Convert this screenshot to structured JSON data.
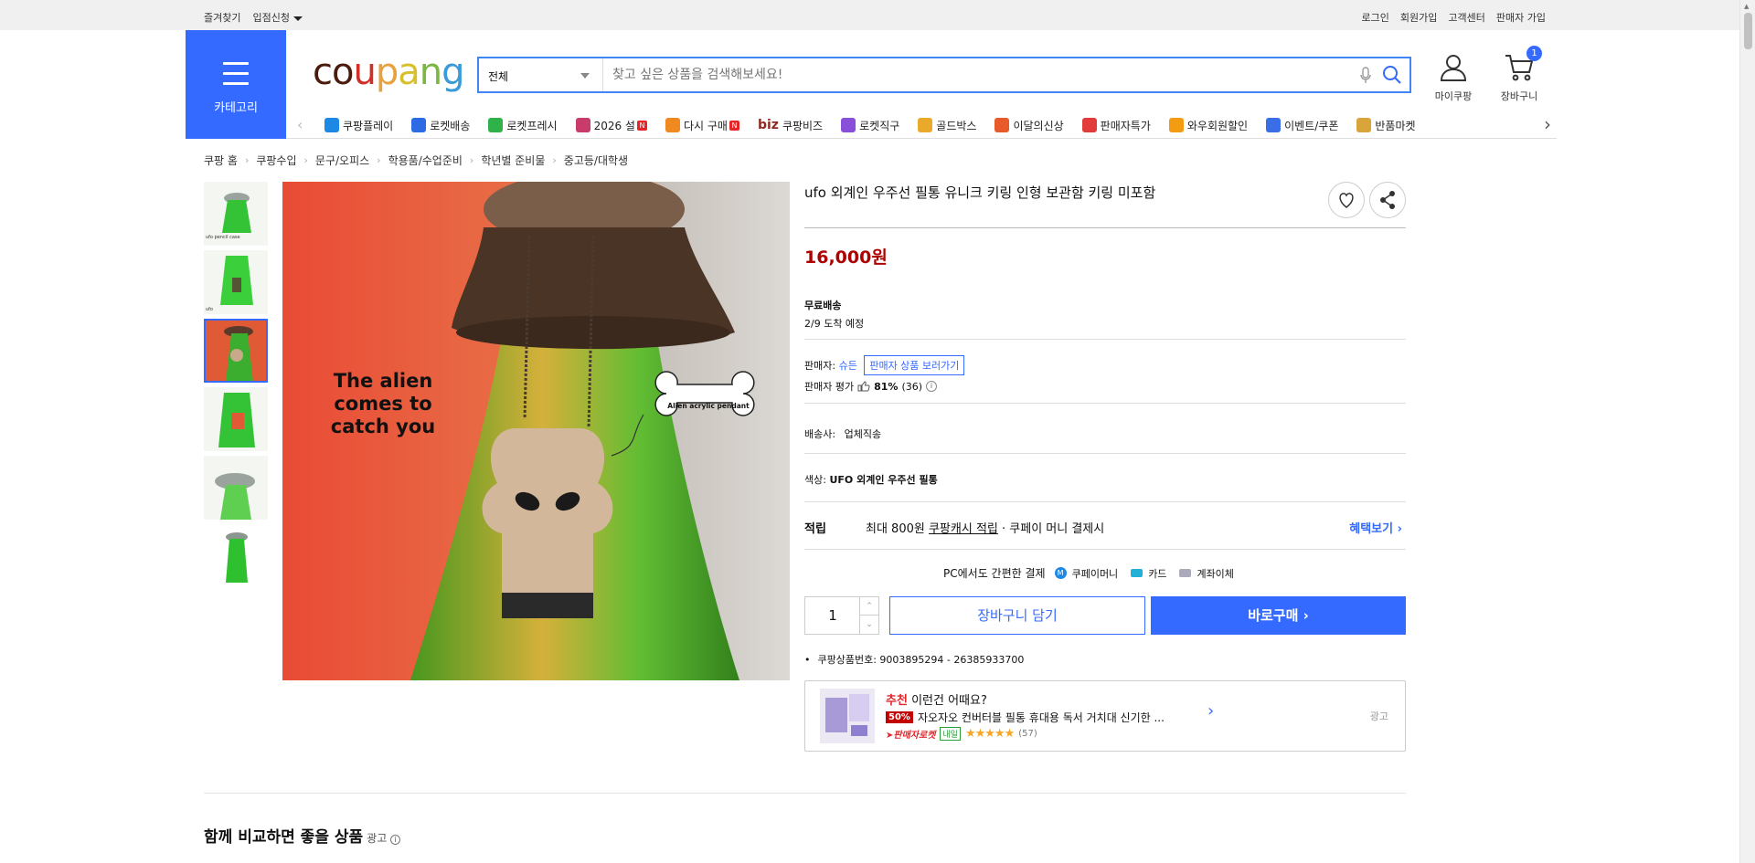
{
  "topbar": {
    "favorites": "즐겨찾기",
    "entry": "입점신청",
    "login": "로그인",
    "signup": "회원가입",
    "support": "고객센터",
    "seller_signup": "판매자 가입"
  },
  "header": {
    "category_label": "카테고리",
    "logo_letters": [
      "c",
      "o",
      "u",
      "p",
      "a",
      "n",
      "g"
    ],
    "logo_colors": [
      "#4b1b0e",
      "#4b1b0e",
      "#d03028",
      "#e7a23f",
      "#d6c12c",
      "#7ab743",
      "#3a9bd9"
    ],
    "search_scope": "전체",
    "search_placeholder": "찾고 싶은 상품을 검색해보세요!",
    "mycoupang": "마이쿠팡",
    "cart": "장바구니",
    "cart_count": "1"
  },
  "nav": {
    "items": [
      {
        "label": "쿠팡플레이",
        "color": "#1e88e5",
        "new": ""
      },
      {
        "label": "로켓배송",
        "color": "#2d6ae3",
        "new": ""
      },
      {
        "label": "로켓프레시",
        "color": "#30b24a",
        "new": ""
      },
      {
        "label": "2026 설",
        "color": "#c73c6a",
        "new": "N"
      },
      {
        "label": "다시 구매",
        "color": "#f08a20",
        "new": "N"
      },
      {
        "label": "쿠팡비즈",
        "color": "#8e2b1f",
        "new": "",
        "prefix": "biz"
      },
      {
        "label": "로켓직구",
        "color": "#8a4fd8",
        "new": ""
      },
      {
        "label": "골드박스",
        "color": "#e9a92a",
        "new": ""
      },
      {
        "label": "이달의신상",
        "color": "#e85a2b",
        "new": ""
      },
      {
        "label": "판매자특가",
        "color": "#e23b3b",
        "new": ""
      },
      {
        "label": "와우회원할인",
        "color": "#f39c12",
        "new": ""
      },
      {
        "label": "이벤트/쿠폰",
        "color": "#3a6ee8",
        "new": ""
      },
      {
        "label": "반품마켓",
        "color": "#d9a43a",
        "new": ""
      }
    ]
  },
  "breadcrumb": [
    "쿠팡 홈",
    "쿠팡수입",
    "문구/오피스",
    "학용품/수업준비",
    "학년별 준비물",
    "중고등/대학생"
  ],
  "image": {
    "caption_line1": "The alien",
    "caption_line2": "comes to",
    "caption_line3": "catch you",
    "pendant_label": "Alien acrylic pendant",
    "thumb_text": "ufo pencil case"
  },
  "product": {
    "title": "ufo 외계인 우주선 필통 유니크 키링 인형 보관함 키링 미포함",
    "price": "16,000원",
    "shipping_title": "무료배송",
    "shipping_eta": "2/9 도착 예정",
    "seller_label": "판매자:",
    "seller_name": "슈든",
    "seller_more": "판매자 상품 보러가기",
    "rating_label": "판매자 평가",
    "rating_pct": "81%",
    "rating_count": "(36)",
    "shipper_label": "배송사:",
    "shipper": "업체직송",
    "color_label": "색상:",
    "color_value": "UFO 외계인 우주선 필통",
    "reward_title": "적립",
    "reward_prefix": "최대 800원",
    "reward_link": "쿠팡캐시 적립",
    "reward_suffix": "· 쿠페이 머니 결제시",
    "benefit_link": "혜택보기",
    "pay_title": "PC에서도 간편한 결제",
    "pay_money": "쿠페이머니",
    "pay_card": "카드",
    "pay_bank": "계좌이체",
    "qty": "1",
    "cart_btn": "장바구니 담기",
    "buy_btn": "바로구매",
    "product_no": "쿠팡상품번호: 9003895294 - 26385933700"
  },
  "recommend": {
    "label_red": "추천",
    "label_rest": "이런건 어때요?",
    "discount": "50%",
    "item_title": "자오자오 컨버터블 필통 휴대용 독서 거치대 신기한 ...",
    "seller_rocket": "판매자로켓",
    "tomorrow": "내일",
    "stars": "★★★★★",
    "reviews": "(57)",
    "ad": "광고"
  },
  "section": {
    "compare_title": "함께 비교하면 좋을 상품",
    "ad": "광고"
  }
}
